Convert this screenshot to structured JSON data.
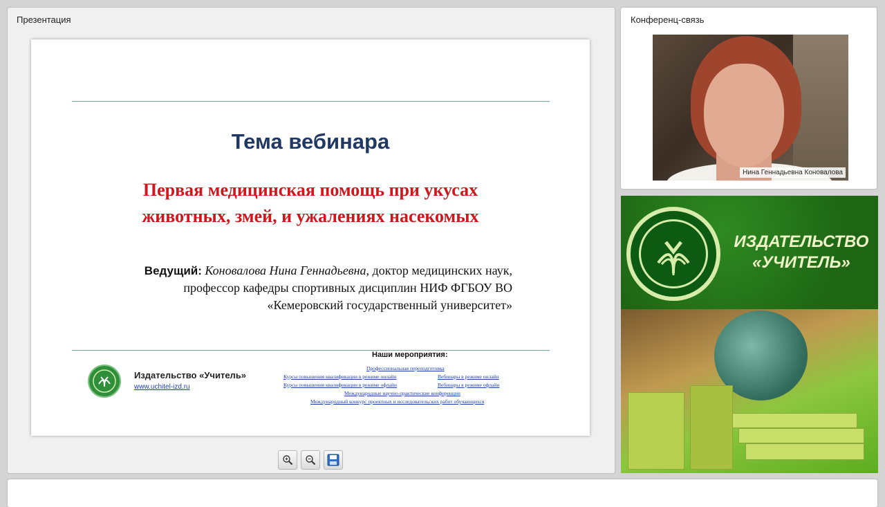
{
  "presentation_panel": {
    "title": "Презентация",
    "slide": {
      "heading": "Тема вебинара",
      "topic_line1": "Первая медицинская помощь при укусах",
      "topic_line2": "животных, змей, и ужалениях насекомых",
      "host_label": "Ведущий:",
      "host_name": "Коновалова Нина Геннадьевна",
      "host_line1_rest": ", доктор медицинских наук,",
      "host_line2": "профессор кафедры спортивных дисциплин НИФ ФГБОУ ВО",
      "host_line3": "«Кемеровский государственный университет»",
      "publisher": "Издательство «Учитель»",
      "publisher_url": "www.uchitel-izd.ru",
      "events_title": "Наши мероприятия",
      "events": [
        "Профессиональная переподготовка",
        "Курсы повышения квалификации в режиме онлайн",
        "Вебинары в режиме онлайн",
        "Курсы повышения квалификации в режиме офлайн",
        "Вебинары в режиме офлайн",
        "Международные научно-практические конференции",
        "Международный конкурс проектных и исследовательских работ обучающихся"
      ]
    },
    "toolbar": {
      "zoom_in_icon": "zoom-in-icon",
      "zoom_out_icon": "zoom-out-icon",
      "save_icon": "save-icon"
    }
  },
  "conference_panel": {
    "title": "Конференц-связь",
    "participant_name": "Нина Геннадьевна Коновалова"
  },
  "advert": {
    "title_line1": "ИЗДАТЕЛЬСТВО",
    "title_line2": "«УЧИТЕЛЬ»"
  },
  "colors": {
    "heading": "#1f3864",
    "topic": "#d0171d",
    "brand_green": "#1e6614"
  }
}
